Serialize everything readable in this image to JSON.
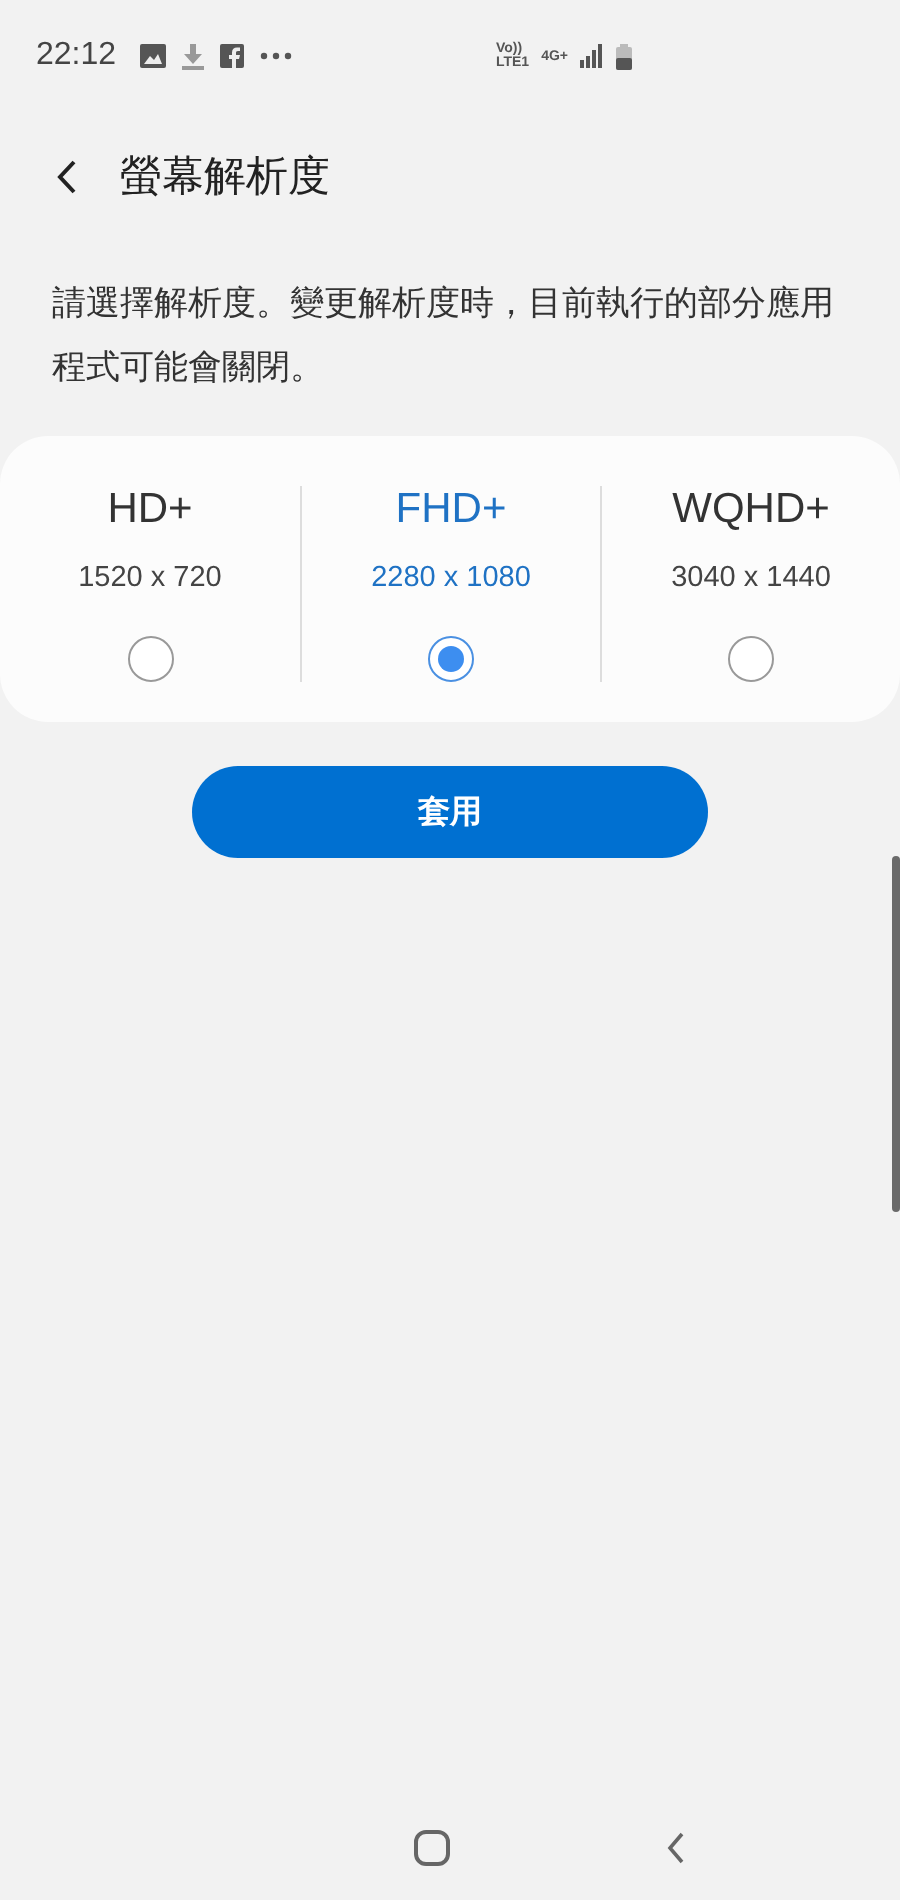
{
  "status_bar": {
    "time": "22:12",
    "network": [
      "Vo))",
      "LTE1"
    ],
    "mobile_data": "4G+"
  },
  "header": {
    "title": "螢幕解析度"
  },
  "description": "請選擇解析度。變更解析度時，目前執行的部分應用程式可能會關閉。",
  "resolutions": [
    {
      "name": "HD+",
      "size": "1520 x 720",
      "selected": false
    },
    {
      "name": "FHD+",
      "size": "2280 x 1080",
      "selected": true
    },
    {
      "name": "WQHD+",
      "size": "3040 x 1440",
      "selected": false
    }
  ],
  "apply_button": "套用"
}
